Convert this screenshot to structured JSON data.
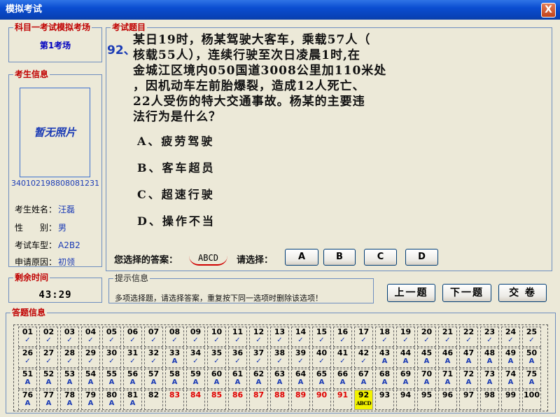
{
  "window": {
    "title": "模拟考试",
    "close_label": "X"
  },
  "room": {
    "legend": "科目一考试模拟考场",
    "name": "第1考场"
  },
  "candidate": {
    "legend": "考生信息",
    "photo_text": "暂无照片",
    "id_number": "340102198808081231",
    "fields": [
      {
        "label": "考生姓名：",
        "value": "汪磊"
      },
      {
        "label": "性　　别：",
        "value": "男"
      },
      {
        "label": "考试车型：",
        "value": "A2B2"
      },
      {
        "label": "申请原因：",
        "value": "初领"
      }
    ]
  },
  "timer": {
    "legend": "剩余时间",
    "value": "43:29"
  },
  "question": {
    "legend": "考试题目",
    "number": "92、",
    "lines": [
      "某日19时，杨某驾驶大客车，乘载57人（",
      "核载55人），连续行驶至次日凌晨1时,在",
      "金城江区境内050国道3008公里加110米处",
      "，因机动车左前胎爆裂，造成12人死亡、",
      "22人受伤的特大交通事故。杨某的主要违",
      "法行为是什么？"
    ],
    "options": [
      "A、疲劳驾驶",
      "B、客车超员",
      "C、超速行驶",
      "D、操作不当"
    ]
  },
  "answer": {
    "selected_label": "您选择的答案：",
    "selected_value": "ABCD",
    "choose_label": "请选择：",
    "buttons": [
      "A",
      "B",
      "C",
      "D"
    ]
  },
  "hint": {
    "legend": "提示信息",
    "text": "多项选择题，请选择答案，重复按下同一选项时删除该选项！"
  },
  "nav": {
    "prev": "上一题",
    "next": "下一题",
    "submit": "交 卷"
  },
  "sheet": {
    "legend": "答题信息",
    "cells": [
      {
        "n": "01",
        "m": "✓"
      },
      {
        "n": "02",
        "m": "✓"
      },
      {
        "n": "03",
        "m": "✓"
      },
      {
        "n": "04",
        "m": "✓"
      },
      {
        "n": "05",
        "m": "✓"
      },
      {
        "n": "06",
        "m": "✓"
      },
      {
        "n": "07",
        "m": "✓"
      },
      {
        "n": "08",
        "m": "✓"
      },
      {
        "n": "09",
        "m": "✓"
      },
      {
        "n": "10",
        "m": "✓"
      },
      {
        "n": "11",
        "m": "✓"
      },
      {
        "n": "12",
        "m": "✓"
      },
      {
        "n": "13",
        "m": "✓"
      },
      {
        "n": "14",
        "m": "✓"
      },
      {
        "n": "15",
        "m": "✓"
      },
      {
        "n": "16",
        "m": "✓"
      },
      {
        "n": "17",
        "m": "✓"
      },
      {
        "n": "18",
        "m": "✓"
      },
      {
        "n": "19",
        "m": "✓"
      },
      {
        "n": "20",
        "m": "✓"
      },
      {
        "n": "21",
        "m": "✓"
      },
      {
        "n": "22",
        "m": "✓"
      },
      {
        "n": "23",
        "m": "✓"
      },
      {
        "n": "24",
        "m": "✓"
      },
      {
        "n": "25",
        "m": "✓"
      },
      {
        "n": "26",
        "m": "✓"
      },
      {
        "n": "27",
        "m": "✓"
      },
      {
        "n": "28",
        "m": "✓"
      },
      {
        "n": "29",
        "m": "✓"
      },
      {
        "n": "30",
        "m": "✓"
      },
      {
        "n": "31",
        "m": "✓"
      },
      {
        "n": "32",
        "m": "✓"
      },
      {
        "n": "33",
        "m": "A"
      },
      {
        "n": "34",
        "m": "✓"
      },
      {
        "n": "35",
        "m": "✓"
      },
      {
        "n": "36",
        "m": "✓"
      },
      {
        "n": "37",
        "m": "✓"
      },
      {
        "n": "38",
        "m": "✓"
      },
      {
        "n": "39",
        "m": "✓"
      },
      {
        "n": "40",
        "m": "✓"
      },
      {
        "n": "41",
        "m": "✓"
      },
      {
        "n": "42",
        "m": "✓"
      },
      {
        "n": "43",
        "m": "A"
      },
      {
        "n": "44",
        "m": "A"
      },
      {
        "n": "45",
        "m": "A"
      },
      {
        "n": "46",
        "m": "A"
      },
      {
        "n": "47",
        "m": "A"
      },
      {
        "n": "48",
        "m": "A"
      },
      {
        "n": "49",
        "m": "A"
      },
      {
        "n": "50",
        "m": "A"
      },
      {
        "n": "51",
        "m": "A"
      },
      {
        "n": "52",
        "m": "A"
      },
      {
        "n": "53",
        "m": "A"
      },
      {
        "n": "54",
        "m": "A"
      },
      {
        "n": "55",
        "m": "A"
      },
      {
        "n": "56",
        "m": "A"
      },
      {
        "n": "57",
        "m": "A"
      },
      {
        "n": "58",
        "m": "A"
      },
      {
        "n": "59",
        "m": "A"
      },
      {
        "n": "60",
        "m": "A"
      },
      {
        "n": "61",
        "m": "A"
      },
      {
        "n": "62",
        "m": "A"
      },
      {
        "n": "63",
        "m": "A"
      },
      {
        "n": "64",
        "m": "A"
      },
      {
        "n": "65",
        "m": "A"
      },
      {
        "n": "66",
        "m": "A"
      },
      {
        "n": "67",
        "m": "A"
      },
      {
        "n": "68",
        "m": "A"
      },
      {
        "n": "69",
        "m": "A"
      },
      {
        "n": "70",
        "m": "A"
      },
      {
        "n": "71",
        "m": "A"
      },
      {
        "n": "72",
        "m": "A"
      },
      {
        "n": "73",
        "m": "A"
      },
      {
        "n": "74",
        "m": "A"
      },
      {
        "n": "75",
        "m": "A"
      },
      {
        "n": "76",
        "m": "A"
      },
      {
        "n": "77",
        "m": "A"
      },
      {
        "n": "78",
        "m": "A"
      },
      {
        "n": "79",
        "m": "A"
      },
      {
        "n": "80",
        "m": "A"
      },
      {
        "n": "81",
        "m": "A"
      },
      {
        "n": "82",
        "m": ""
      },
      {
        "n": "83",
        "m": "",
        "red": true
      },
      {
        "n": "84",
        "m": "",
        "red": true
      },
      {
        "n": "85",
        "m": "",
        "red": true
      },
      {
        "n": "86",
        "m": "",
        "red": true
      },
      {
        "n": "87",
        "m": "",
        "red": true
      },
      {
        "n": "88",
        "m": "",
        "red": true
      },
      {
        "n": "89",
        "m": "",
        "red": true
      },
      {
        "n": "90",
        "m": "",
        "red": true
      },
      {
        "n": "91",
        "m": "",
        "red": true
      },
      {
        "n": "92",
        "m": "ABCD",
        "current": true
      },
      {
        "n": "93",
        "m": ""
      },
      {
        "n": "94",
        "m": ""
      },
      {
        "n": "95",
        "m": ""
      },
      {
        "n": "96",
        "m": ""
      },
      {
        "n": "97",
        "m": ""
      },
      {
        "n": "98",
        "m": ""
      },
      {
        "n": "99",
        "m": ""
      },
      {
        "n": "100",
        "m": ""
      }
    ]
  },
  "colors": {
    "titlebar": "#0A4DD1",
    "legend": "#C00000",
    "value_blue": "#1B3BB5",
    "wrong_red": "#E00000",
    "current_yellow": "#F2F200",
    "background": "#ECE9D8"
  }
}
